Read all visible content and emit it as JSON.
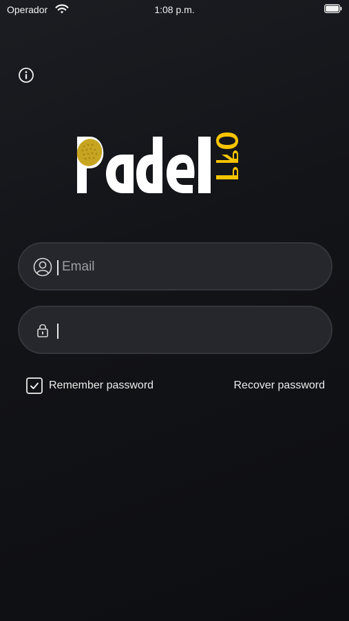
{
  "status_bar": {
    "carrier": "Operador",
    "time": "1:08 p.m.",
    "wifi_icon": "wifi-icon",
    "battery_icon": "battery-icon"
  },
  "header": {
    "info_icon": "info-icon"
  },
  "logo": {
    "text": "Padel",
    "badge": "PRO",
    "accent_color": "#f5c400"
  },
  "login": {
    "email": {
      "placeholder": "Email",
      "value": "",
      "icon": "user-icon"
    },
    "password": {
      "placeholder": "",
      "value": "",
      "icon": "lock-icon"
    },
    "remember": {
      "label": "Remember password",
      "checked": true
    },
    "recover_label": "Recover password"
  },
  "colors": {
    "background": "#131418",
    "field_bg": "#25272c",
    "text": "#e9e9ea",
    "accent": "#f5c400"
  }
}
